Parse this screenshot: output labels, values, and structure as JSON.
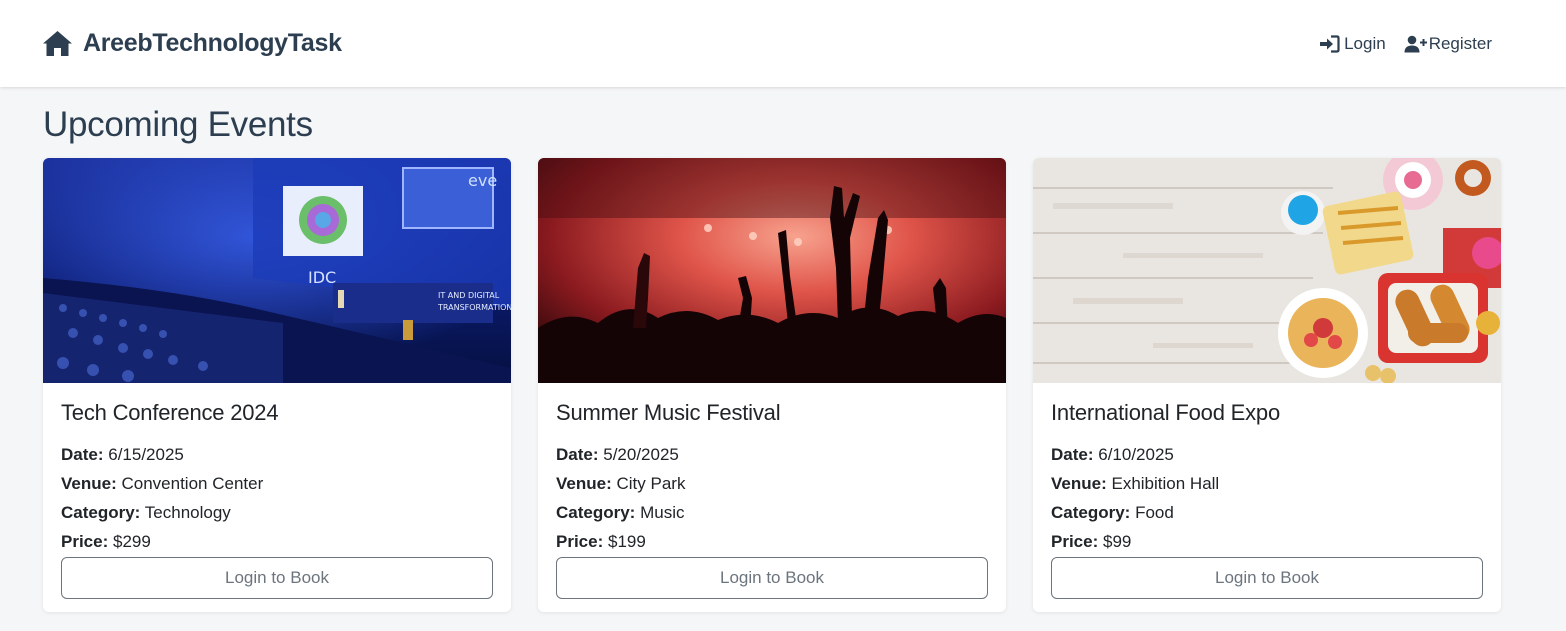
{
  "navbar": {
    "brand": "AreebTechnologyTask",
    "brand_icon": "home-icon",
    "login_label": "Login",
    "login_icon": "sign-in-icon",
    "register_label": "Register",
    "register_icon": "user-plus-icon"
  },
  "page": {
    "title": "Upcoming Events"
  },
  "labels": {
    "date": "Date:",
    "venue": "Venue:",
    "category": "Category:",
    "price": "Price:"
  },
  "events": [
    {
      "title": "Tech Conference 2024",
      "date": "6/15/2025",
      "venue": "Convention Center",
      "category": "Technology",
      "price": "$299",
      "button": "Login to Book",
      "image": "conference-photo"
    },
    {
      "title": "Summer Music Festival",
      "date": "5/20/2025",
      "venue": "City Park",
      "category": "Music",
      "price": "$199",
      "button": "Login to Book",
      "image": "concert-photo"
    },
    {
      "title": "International Food Expo",
      "date": "6/10/2025",
      "venue": "Exhibition Hall",
      "category": "Food",
      "price": "$99",
      "button": "Login to Book",
      "image": "food-photo"
    }
  ],
  "colors": {
    "brand": "#2c3e50",
    "page_bg": "#f5f6f8",
    "button_border": "#6c757d"
  }
}
